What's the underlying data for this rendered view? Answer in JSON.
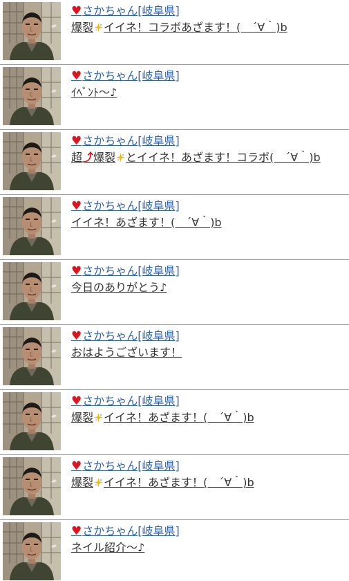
{
  "colors": {
    "link": "#2a62b8",
    "heart": "#e0141e",
    "message": "#333333",
    "divider": "#8e8e8e"
  },
  "icons": {
    "heart": "heart-icon",
    "sparkle": "sparkle-icon",
    "arrow": "arrow-up-right-icon"
  },
  "posts": [
    {
      "heart": "♥",
      "name": "さかちゃん[岐阜県]",
      "parts": [
        "爆裂",
        "イイネ！コラボあざます！(　´∀｀)b"
      ]
    },
    {
      "heart": "♥",
      "name": "さかちゃん[岐阜県]",
      "parts": [
        "ｲﾍﾞﾝﾄ～♪"
      ]
    },
    {
      "heart": "♥",
      "name": "さかちゃん[岐阜県]",
      "parts": [
        "超",
        "⤴",
        "爆裂",
        "とイイネ！あざます！コラボ(　´∀｀)b"
      ]
    },
    {
      "heart": "♥",
      "name": "さかちゃん[岐阜県]",
      "parts": [
        "イイネ！あざます！(　´∀｀)b"
      ]
    },
    {
      "heart": "♥",
      "name": "さかちゃん[岐阜県]",
      "parts": [
        "今日のありがとう♪"
      ]
    },
    {
      "heart": "♥",
      "name": "さかちゃん[岐阜県]",
      "parts": [
        "おはようございます！"
      ]
    },
    {
      "heart": "♥",
      "name": "さかちゃん[岐阜県]",
      "parts": [
        "爆裂",
        "イイネ！あざます！(　´∀｀)b"
      ]
    },
    {
      "heart": "♥",
      "name": "さかちゃん[岐阜県]",
      "parts": [
        "爆裂",
        "イイネ！あざます！(　´∀｀)b"
      ]
    },
    {
      "heart": "♥",
      "name": "さかちゃん[岐阜県]",
      "parts": [
        "ネイル紹介～♪"
      ]
    }
  ]
}
